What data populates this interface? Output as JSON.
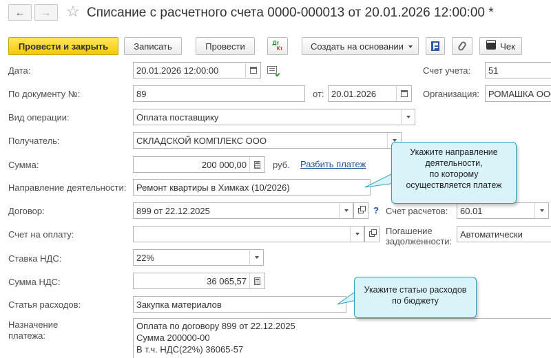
{
  "window": {
    "title": "Списание с расчетного счета 0000-000013 от 20.01.2026 12:00:00 *"
  },
  "nav": {
    "back_symbol": "←",
    "forward_symbol": "→",
    "star_symbol": "☆"
  },
  "toolbar": {
    "post_close": "Провести и закрыть",
    "save": "Записать",
    "post": "Провести",
    "dt_label": "Дт",
    "kt_label": "Кт",
    "create_based": "Создать на основании",
    "check": "Чек"
  },
  "form": {
    "date_label": "Дата:",
    "date_value": "20.01.2026 12:00:00",
    "account_label": "Счет учета:",
    "account_value": "51",
    "doc_label": "По документу №:",
    "doc_value": "89",
    "from_label": "от:",
    "from_value": "20.01.2026",
    "org_label": "Организация:",
    "org_value": "РОМАШКА ООО",
    "op_type_label": "Вид операции:",
    "op_type_value": "Оплата поставщику",
    "recipient_label": "Получатель:",
    "recipient_value": "СКЛАДСКОЙ КОМПЛЕКС ООО",
    "sum_label": "Сумма:",
    "sum_value": "200 000,00",
    "currency": "руб.",
    "split_payment": "Разбить платеж",
    "activity_label": "Направление деятельности:",
    "activity_value": "Ремонт квартиры в Химках (10/2026)",
    "contract_label": "Договор:",
    "contract_value": "899 от 22.12.2025",
    "question_mark": "?",
    "settle_acc_label": "Счет расчетов:",
    "settle_acc_value": "60.01",
    "invoice_label": "Счет на оплату:",
    "invoice_value": "",
    "debt_label_1": "Погашение",
    "debt_label_2": "задолженности:",
    "debt_value": "Автоматически",
    "vat_rate_label": "Ставка НДС:",
    "vat_rate_value": "22%",
    "vat_sum_label": "Сумма НДС:",
    "vat_sum_value": "36 065,57",
    "expense_label": "Статья расходов:",
    "expense_value": "Закупка материалов",
    "purpose_label_1": "Назначение",
    "purpose_label_2": "платежа:",
    "purpose_lines": [
      "Оплата по договору 899 от 22.12.2025",
      "Сумма 200000-00",
      "В т.ч. НДС(22%) 36065-57"
    ]
  },
  "callouts": {
    "activity": [
      "Укажите направление",
      "деятельности,",
      "по которому",
      "осуществляется платеж"
    ],
    "expense": [
      "Укажите статью расходов",
      "по бюджету"
    ]
  },
  "colors": {
    "primary_button": "#f4c80b",
    "link": "#1e50a0",
    "callout_bg": "#d9f4f8",
    "callout_border": "#2aa2c2"
  }
}
